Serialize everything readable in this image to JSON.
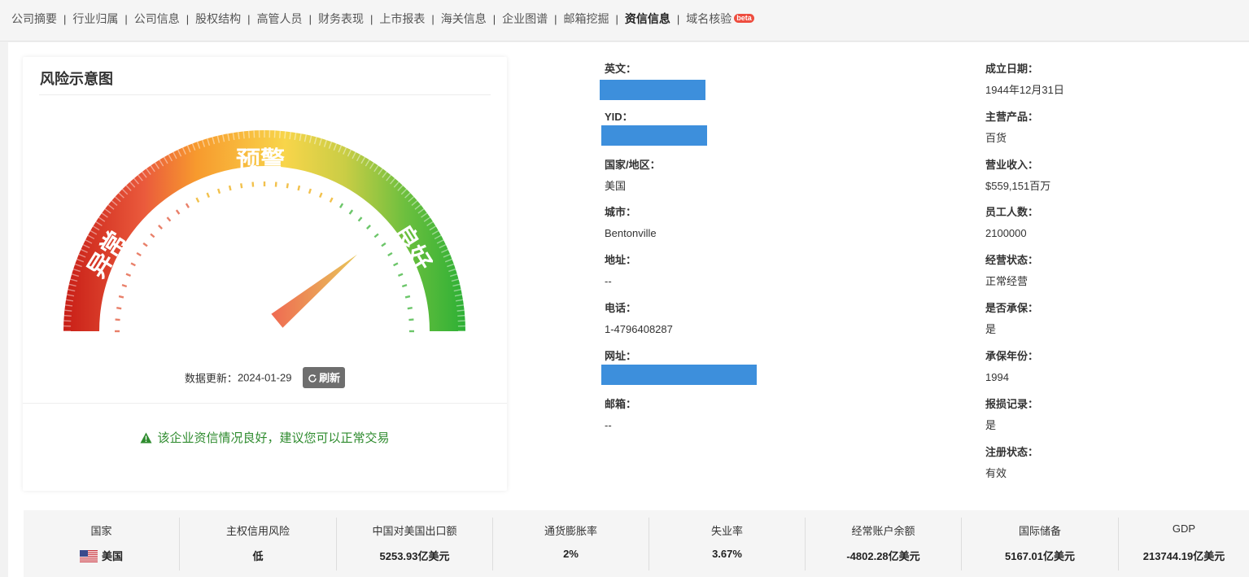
{
  "tabs": [
    {
      "label": "公司摘要"
    },
    {
      "label": "行业归属"
    },
    {
      "label": "公司信息"
    },
    {
      "label": "股权结构"
    },
    {
      "label": "高管人员"
    },
    {
      "label": "财务表现"
    },
    {
      "label": "上市报表"
    },
    {
      "label": "海关信息"
    },
    {
      "label": "企业图谱"
    },
    {
      "label": "邮箱挖掘"
    },
    {
      "label": "资信信息",
      "active": true
    },
    {
      "label": "域名核验",
      "badge": "beta"
    }
  ],
  "risk_card": {
    "title": "风险示意图",
    "zones": {
      "bad": "异常",
      "warn": "预警",
      "good": "良好"
    },
    "needle_level_pct": 78,
    "update_label": "数据更新：",
    "update_date": "2024-01-29",
    "refresh_label": "刷新",
    "advice": "该企业资信情况良好，建议您可以正常交易",
    "colors": {
      "bad": "#d02a1e",
      "warn": "#f5a623",
      "good": "#2db83d",
      "advice": "#2e8b2e"
    }
  },
  "info_left": {
    "english_label": "英文：",
    "yid_label": "YID：",
    "country_label": "国家/地区：",
    "country_value": "美国",
    "city_label": "城市：",
    "city_value": "Bentonville",
    "address_label": "地址：",
    "address_value": "--",
    "phone_label": "电话：",
    "phone_value": "1-4796408287",
    "website_label": "网址：",
    "email_label": "邮箱：",
    "email_value": "--"
  },
  "info_right": {
    "founded_label": "成立日期：",
    "founded_value": "1944年12月31日",
    "product_label": "主营产品：",
    "product_value": "百货",
    "revenue_label": "营业收入：",
    "revenue_value": "$559,151百万",
    "employees_label": "员工人数：",
    "employees_value": "2100000",
    "status_label": "经营状态：",
    "status_value": "正常经营",
    "insured_label": "是否承保：",
    "insured_value": "是",
    "insured_year_label": "承保年份：",
    "insured_year_value": "1994",
    "claims_label": "报损记录：",
    "claims_value": "是",
    "reg_label": "注册状态：",
    "reg_value": "有效"
  },
  "stats": [
    {
      "label": "国家",
      "value": "美国",
      "flag": "us-flag-icon"
    },
    {
      "label": "主权信用风险",
      "value": "低"
    },
    {
      "label": "中国对美国出口额",
      "value": "5253.93亿美元"
    },
    {
      "label": "通货膨胀率",
      "value": "2%"
    },
    {
      "label": "失业率",
      "value": "3.67%"
    },
    {
      "label": "经常账户余额",
      "value": "-4802.28亿美元"
    },
    {
      "label": "国际储备",
      "value": "5167.01亿美元"
    },
    {
      "label": "GDP",
      "value": "213744.19亿美元"
    }
  ]
}
